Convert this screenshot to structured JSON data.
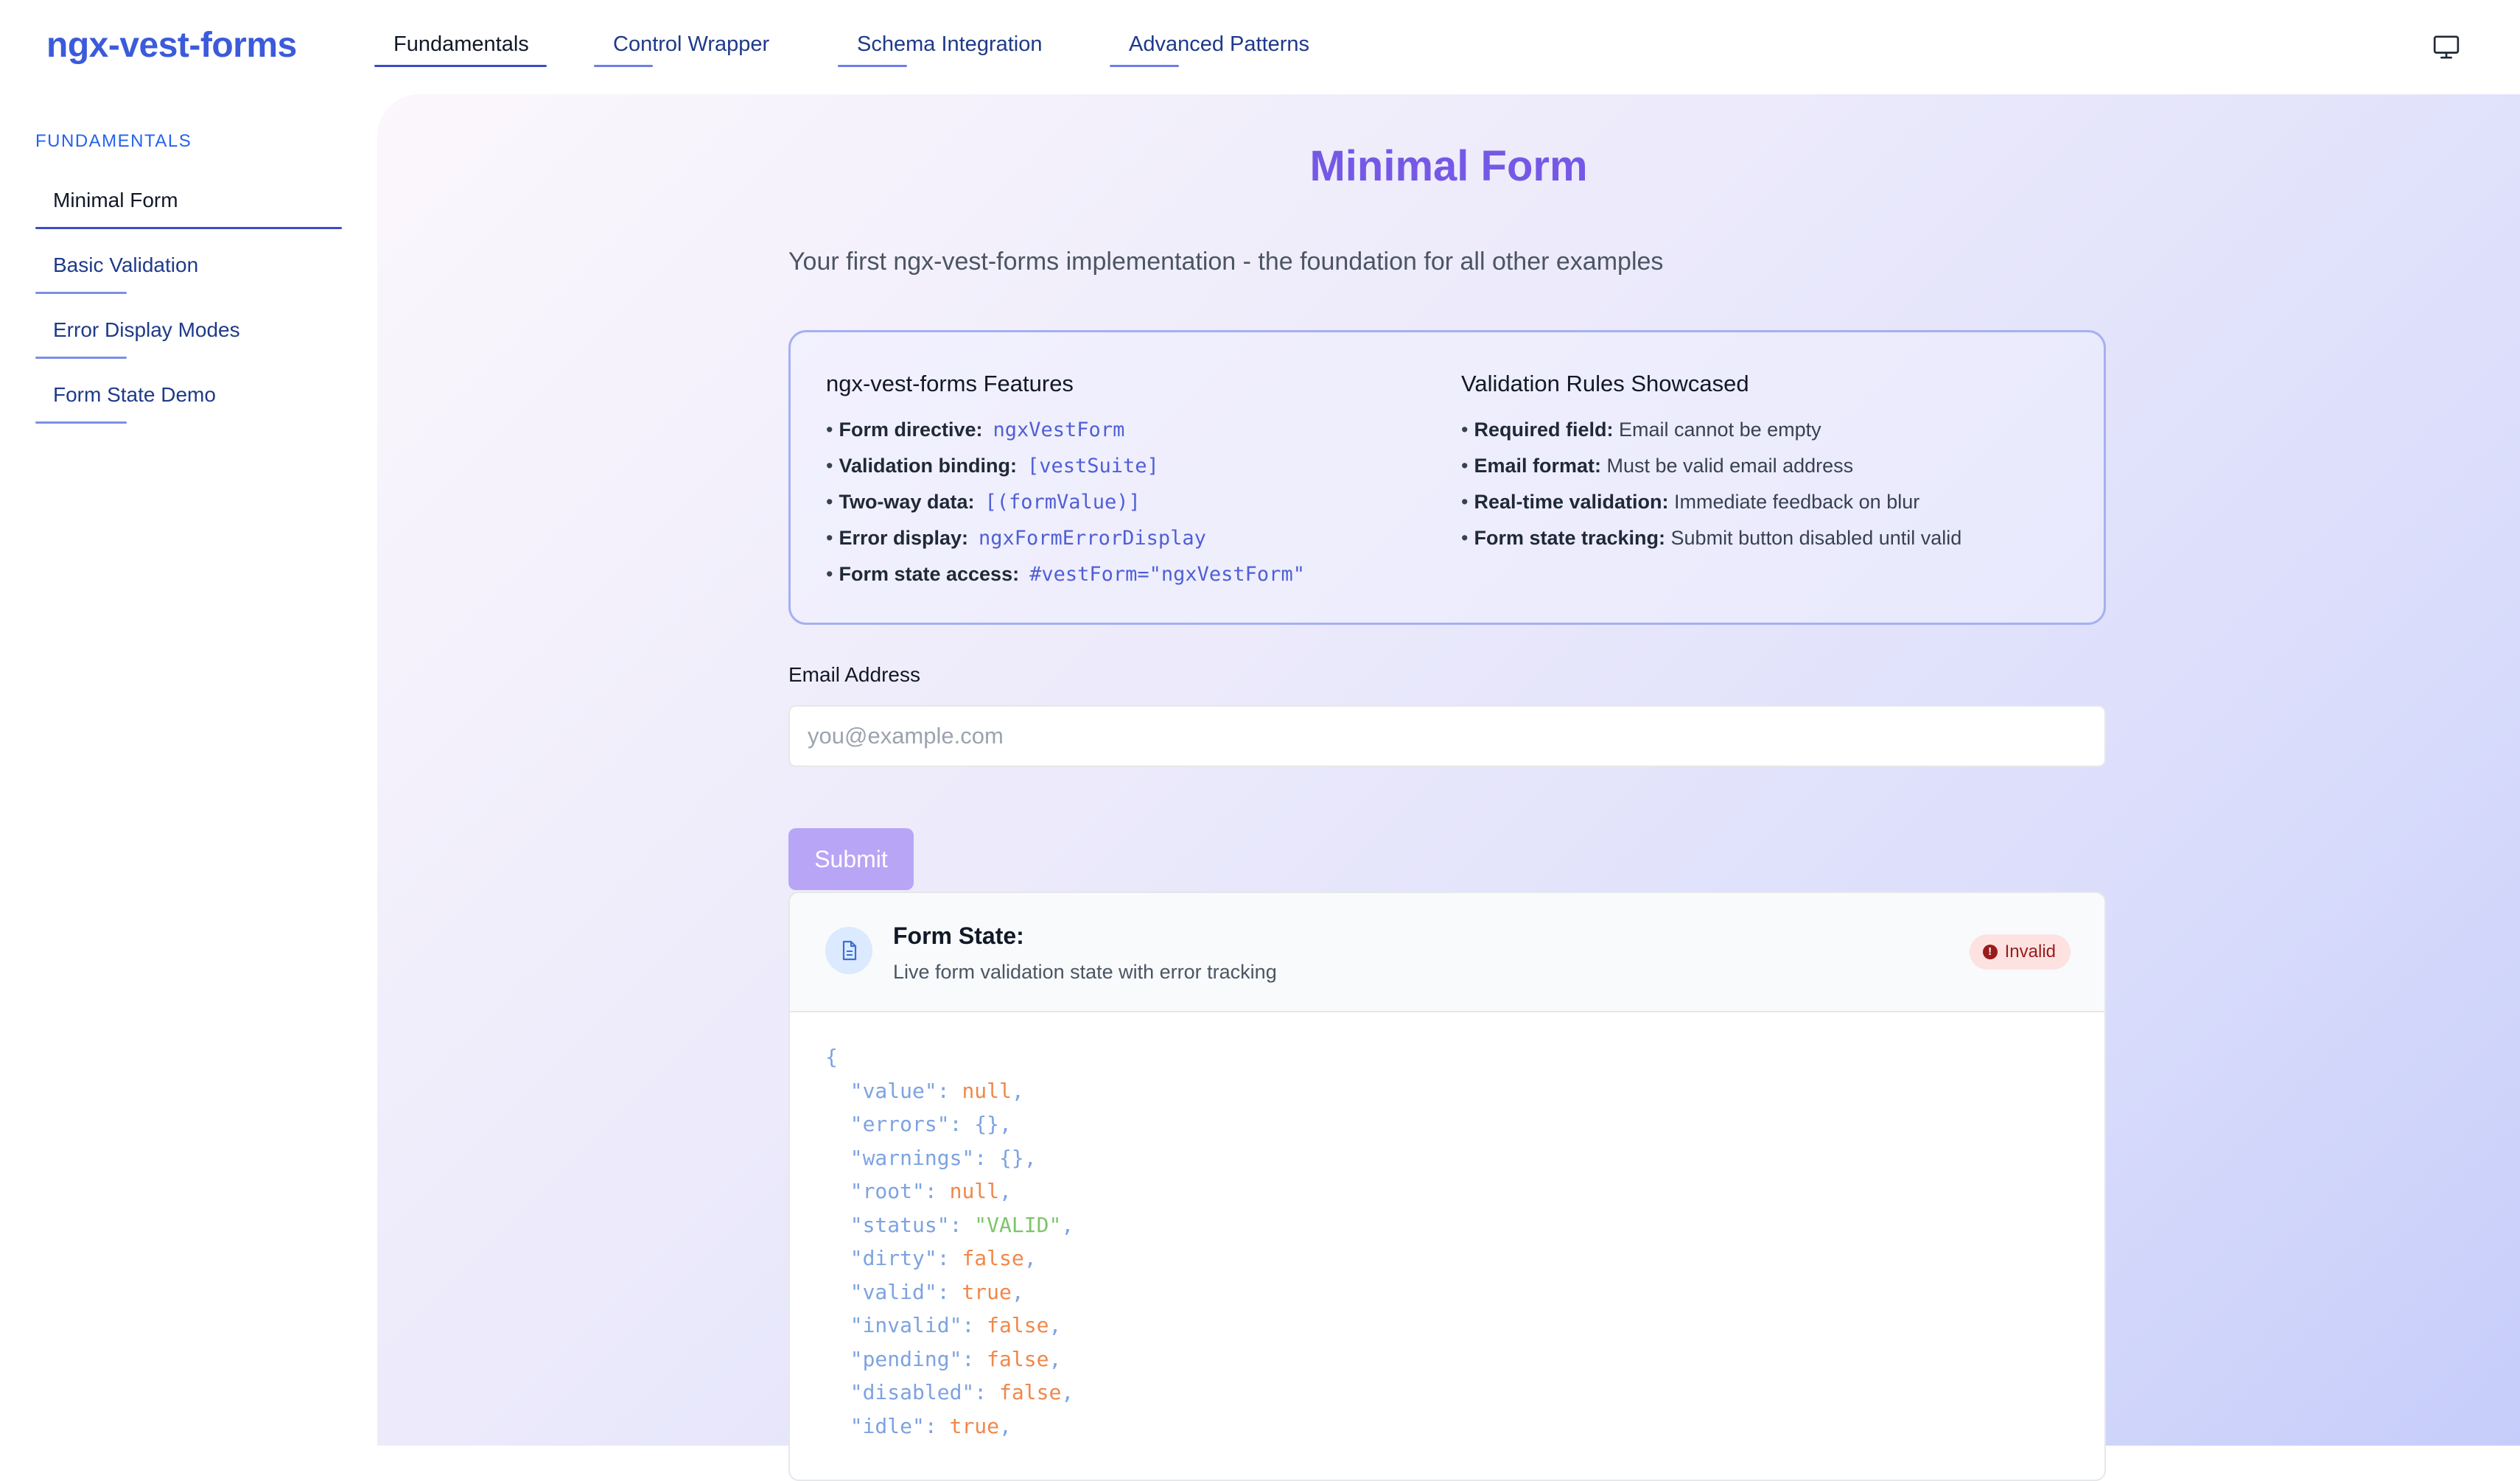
{
  "app": {
    "logo": "ngx-vest-forms"
  },
  "nav": [
    {
      "label": "Fundamentals",
      "active": true
    },
    {
      "label": "Control Wrapper",
      "active": false
    },
    {
      "label": "Schema Integration",
      "active": false
    },
    {
      "label": "Advanced Patterns",
      "active": false
    }
  ],
  "header_icons": {
    "right": "monitor-icon"
  },
  "sidebar": {
    "heading": "FUNDAMENTALS",
    "items": [
      {
        "label": "Minimal Form",
        "active": true
      },
      {
        "label": "Basic Validation",
        "active": false
      },
      {
        "label": "Error Display Modes",
        "active": false
      },
      {
        "label": "Form State Demo",
        "active": false
      }
    ]
  },
  "page": {
    "title": "Minimal Form",
    "subtitle": "Your first ngx-vest-forms implementation - the foundation for all other examples"
  },
  "features": {
    "title": "ngx-vest-forms Features",
    "items": [
      {
        "label": "Form directive:",
        "code": "ngxVestForm"
      },
      {
        "label": "Validation binding:",
        "code": "[vestSuite]"
      },
      {
        "label": "Two-way data:",
        "code": "[(formValue)]"
      },
      {
        "label": "Error display:",
        "code": "ngxFormErrorDisplay"
      },
      {
        "label": "Form state access:",
        "code": "#vestForm=\"ngxVestForm\""
      }
    ]
  },
  "rules": {
    "title": "Validation Rules Showcased",
    "items": [
      {
        "label": "Required field:",
        "text": "Email cannot be empty"
      },
      {
        "label": "Email format:",
        "text": "Must be valid email address"
      },
      {
        "label": "Real-time validation:",
        "text": "Immediate feedback on blur"
      },
      {
        "label": "Form state tracking:",
        "text": "Submit button disabled until valid"
      }
    ]
  },
  "form": {
    "email_label": "Email Address",
    "email_value": "",
    "email_placeholder": "you@example.com",
    "submit_label": "Submit"
  },
  "form_state": {
    "title": "Form State:",
    "subtitle": "Live form validation state with error tracking",
    "badge": "Invalid",
    "badge_icon": "!",
    "json_open": "{",
    "json_lines": [
      {
        "key": "\"value\"",
        "value": "null",
        "type": "null"
      },
      {
        "key": "\"errors\"",
        "value": "{}",
        "type": "punc"
      },
      {
        "key": "\"warnings\"",
        "value": "{}",
        "type": "punc"
      },
      {
        "key": "\"root\"",
        "value": "null",
        "type": "null"
      },
      {
        "key": "\"status\"",
        "value": "\"VALID\"",
        "type": "str"
      },
      {
        "key": "\"dirty\"",
        "value": "false",
        "type": "bool"
      },
      {
        "key": "\"valid\"",
        "value": "true",
        "type": "bool"
      },
      {
        "key": "\"invalid\"",
        "value": "false",
        "type": "bool"
      },
      {
        "key": "\"pending\"",
        "value": "false",
        "type": "bool"
      },
      {
        "key": "\"disabled\"",
        "value": "false",
        "type": "bool"
      },
      {
        "key": "\"idle\"",
        "value": "true",
        "type": "bool"
      }
    ]
  },
  "colors": {
    "brand": "#3b5bdb",
    "title_purple": "#7559e6",
    "submit_disabled": "#b8a5f5",
    "badge_bg": "#fee2e2",
    "badge_text": "#991b1b"
  }
}
